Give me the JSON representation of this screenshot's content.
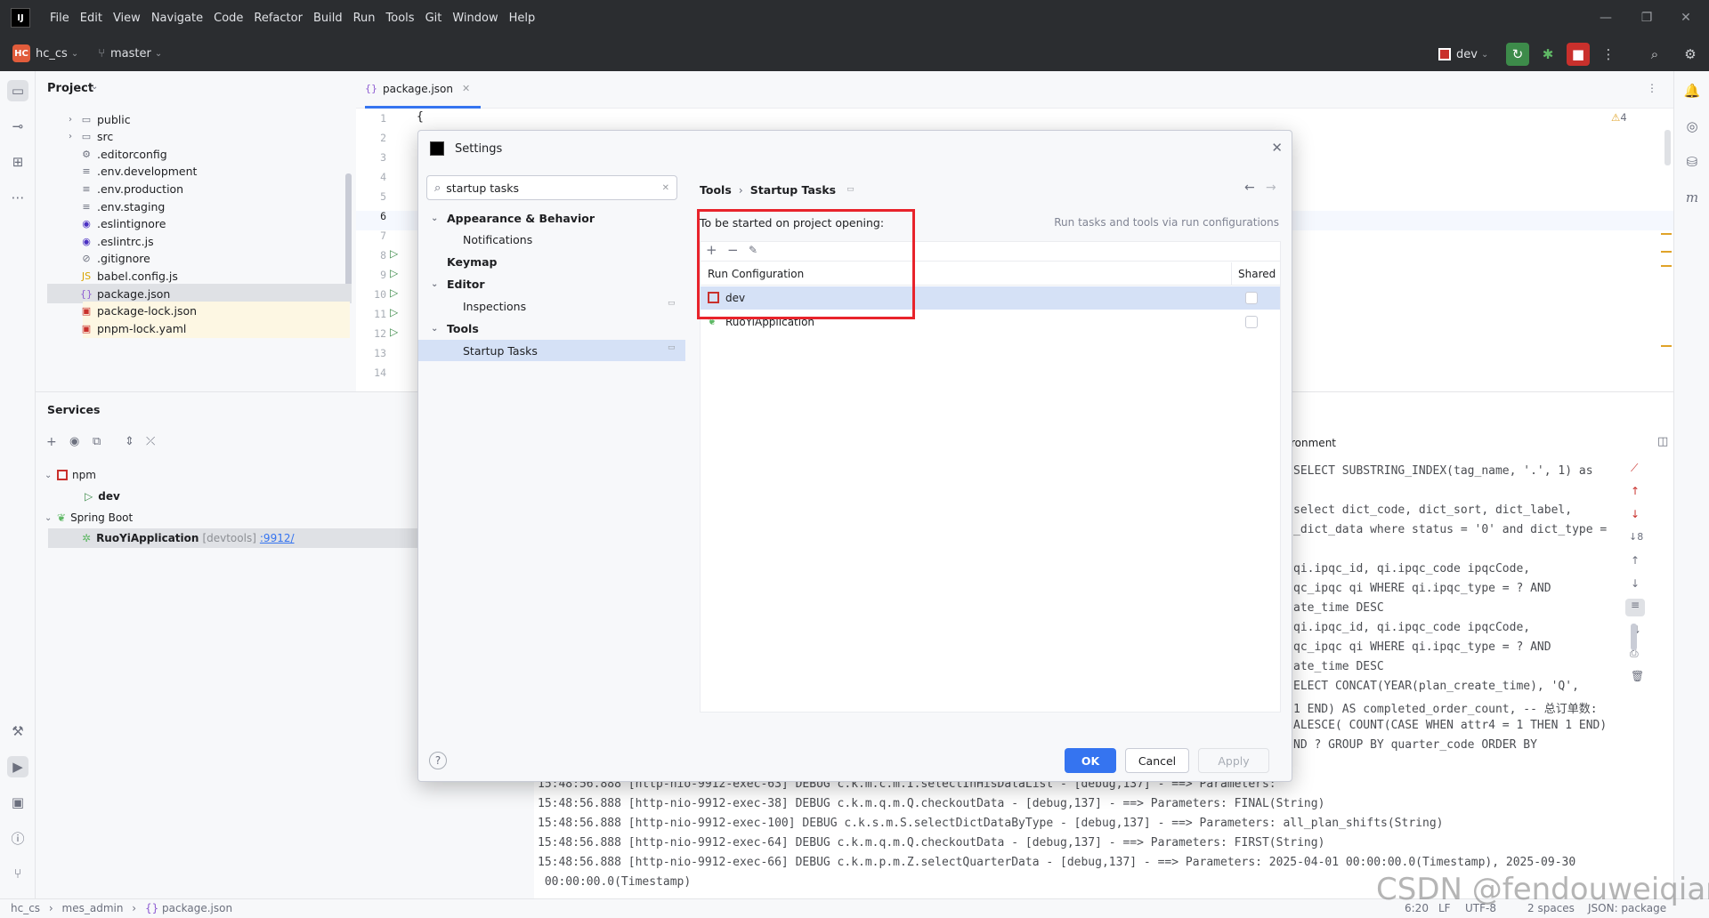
{
  "menubar": {
    "logo_text": "IJ",
    "items": [
      "File",
      "Edit",
      "View",
      "Navigate",
      "Code",
      "Refactor",
      "Build",
      "Run",
      "Tools",
      "Git",
      "Window",
      "Help"
    ]
  },
  "toolbar": {
    "project_badge": "HC",
    "project_name": "hc_cs",
    "branch": "master",
    "run_config": "dev"
  },
  "project_panel": {
    "title": "Project",
    "items": [
      {
        "name": "public",
        "type": "folder"
      },
      {
        "name": "src",
        "type": "folder"
      },
      {
        "name": ".editorconfig",
        "type": "config"
      },
      {
        "name": ".env.development",
        "type": "text"
      },
      {
        "name": ".env.production",
        "type": "text"
      },
      {
        "name": ".env.staging",
        "type": "text"
      },
      {
        "name": ".eslintignore",
        "type": "eslint"
      },
      {
        "name": ".eslintrc.js",
        "type": "eslint"
      },
      {
        "name": ".gitignore",
        "type": "ignore"
      },
      {
        "name": "babel.config.js",
        "type": "js"
      },
      {
        "name": "package.json",
        "type": "json"
      },
      {
        "name": "package-lock.json",
        "type": "npm"
      },
      {
        "name": "pnpm-lock.yaml",
        "type": "npm"
      }
    ]
  },
  "editor": {
    "tab_label": "package.json",
    "line_numbers": [
      "1",
      "2",
      "3",
      "4",
      "5",
      "6",
      "7",
      "8",
      "9",
      "10",
      "11",
      "12",
      "13",
      "14"
    ],
    "first_line": "{",
    "warnings": "4"
  },
  "services": {
    "title": "Services",
    "npm_label": "npm",
    "dev_label": "dev",
    "spring_label": "Spring Boot",
    "app_label": "RuoYiApplication",
    "app_meta": "[devtools]",
    "app_port": ":9912/",
    "env_tab": "ronment"
  },
  "console": {
    "sql_lines": [
      "SELECT SUBSTRING_INDEX(tag_name, '.', 1) as",
      "",
      "select dict_code, dict_sort, dict_label,",
      "_dict_data where status = '0' and dict_type =",
      "",
      "qi.ipqc_id, qi.ipqc_code ipqcCode,",
      "qc_ipqc qi WHERE qi.ipqc_type = ? AND",
      "ate_time DESC",
      "qi.ipqc_id, qi.ipqc_code ipqcCode,",
      "qc_ipqc qi WHERE qi.ipqc_type = ? AND",
      "ate_time DESC",
      "ELECT CONCAT(YEAR(plan_create_time), 'Q',",
      "1 END) AS completed_order_count, -- 总订单数:",
      "ALESCE( COUNT(CASE WHEN attr4 = 1 THEN 1 END)",
      "ND ? GROUP BY quarter_code ORDER BY"
    ],
    "log_lines": [
      "15:48:56.888 [http-nio-9912-exec-63] DEBUG c.k.m.c.m.I.selectInHisDataList - [debug,137] - ==> Parameters:",
      "15:48:56.888 [http-nio-9912-exec-38] DEBUG c.k.m.q.m.Q.checkoutData - [debug,137] - ==> Parameters: FINAL(String)",
      "15:48:56.888 [http-nio-9912-exec-100] DEBUG c.k.s.m.S.selectDictDataByType - [debug,137] - ==> Parameters: all_plan_shifts(String)",
      "15:48:56.888 [http-nio-9912-exec-64] DEBUG c.k.m.q.m.Q.checkoutData - [debug,137] - ==> Parameters: FIRST(String)",
      "15:48:56.888 [http-nio-9912-exec-66] DEBUG c.k.m.p.m.Z.selectQuarterData - [debug,137] - ==> Parameters: 2025-04-01 00:00:00.0(Timestamp), 2025-09-30",
      " 00:00:00.0(Timestamp)"
    ]
  },
  "statusbar": {
    "crumbs": [
      "hc_cs",
      "mes_admin",
      "package.json"
    ],
    "position": "6:20",
    "line_sep": "LF",
    "encoding": "UTF-8",
    "indent": "2 spaces",
    "filetype": "JSON: package",
    "watermark": "CSDN @fendouweiqian"
  },
  "dialog": {
    "title": "Settings",
    "search_value": "startup tasks",
    "nav": {
      "appearance": "Appearance & Behavior",
      "notifications": "Notifications",
      "keymap": "Keymap",
      "editor": "Editor",
      "inspections": "Inspections",
      "tools": "Tools",
      "startup_tasks": "Startup Tasks"
    },
    "breadcrumb_parent": "Tools",
    "breadcrumb_current": "Startup Tasks",
    "section_label": "To be started on project opening:",
    "hint": "Run tasks and tools via run configurations",
    "col_config": "Run Configuration",
    "col_shared": "Shared",
    "rows": [
      {
        "name": "dev",
        "shared": false
      },
      {
        "name": "RuoYiApplication",
        "shared": false
      }
    ],
    "ok": "OK",
    "cancel": "Cancel",
    "apply": "Apply",
    "help": "?"
  }
}
